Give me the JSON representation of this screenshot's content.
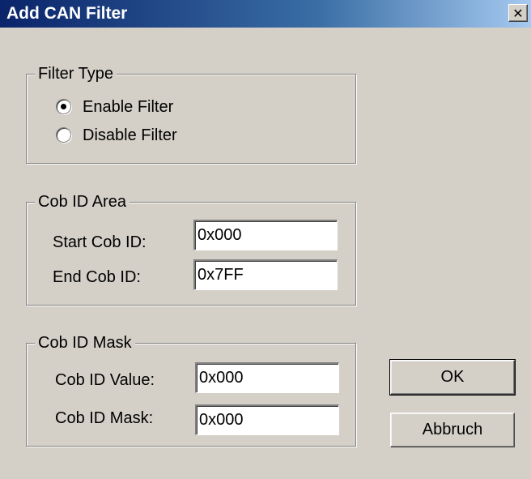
{
  "window": {
    "title": "Add CAN Filter",
    "close_glyph": "✕"
  },
  "filter_type": {
    "legend": "Filter Type",
    "options": [
      {
        "label": "Enable Filter",
        "selected": true
      },
      {
        "label": "Disable Filter",
        "selected": false
      }
    ]
  },
  "cob_id_area": {
    "legend": "Cob ID Area",
    "start_label": "Start Cob ID:",
    "start_value": "0x000",
    "end_label": "End Cob ID:",
    "end_value": "0x7FF"
  },
  "cob_id_mask": {
    "legend": "Cob ID Mask",
    "value_label": "Cob ID Value:",
    "value_value": "0x000",
    "mask_label": "Cob ID Mask:",
    "mask_value": "0x000"
  },
  "buttons": {
    "ok": "OK",
    "cancel": "Abbruch"
  }
}
